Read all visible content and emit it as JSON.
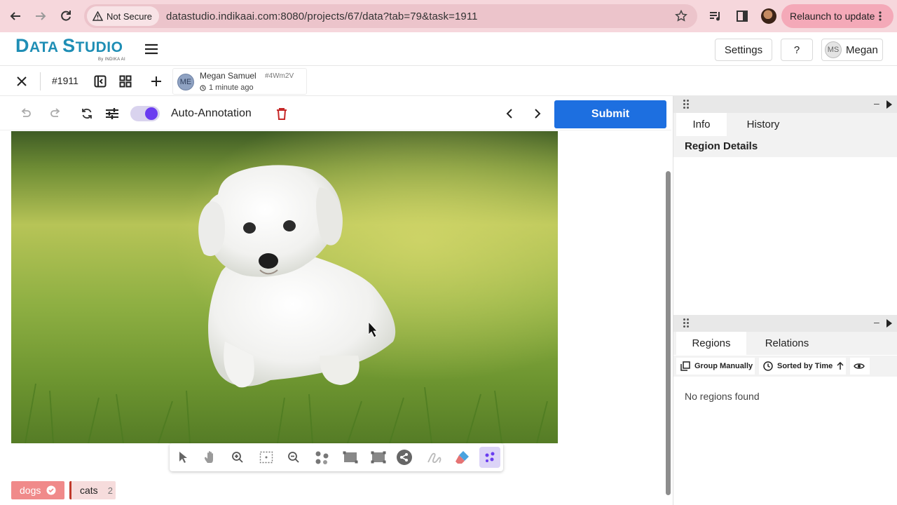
{
  "browser": {
    "security_label": "Not Secure",
    "url": "datastudio.indikaai.com:8080/projects/67/data?tab=79&task=1911",
    "relaunch_label": "Relaunch to update"
  },
  "app": {
    "logo_text_big1": "D",
    "logo_text_small1": "ATA ",
    "logo_text_big2": "S",
    "logo_text_small2": "TUDIO",
    "logo_sub": "By INDIKA AI",
    "settings_label": "Settings",
    "help_label": "?",
    "user_initials": "MS",
    "user_name": "Megan"
  },
  "task": {
    "id": "#1911",
    "annotator_initials": "ME",
    "annotator_name": "Megan Samuel",
    "annotator_code": "#4Wm2V",
    "updated": "1 minute ago"
  },
  "editor": {
    "auto_annotation_label": "Auto-Annotation",
    "auto_annotation_on": true,
    "submit_label": "Submit"
  },
  "labels": [
    {
      "name": "dogs",
      "checked": true,
      "color": "#f08a8a"
    },
    {
      "name": "cats",
      "count": "2",
      "color": "#f6dcdc"
    }
  ],
  "right_panel": {
    "top_tabs": [
      "Info",
      "History"
    ],
    "region_details_title": "Region Details",
    "bottom_tabs": [
      "Regions",
      "Relations"
    ],
    "group_manually_label": "Group Manually",
    "sorted_label": "Sorted by Time",
    "empty_text": "No regions found"
  },
  "colors": {
    "accent": "#1d6fe0",
    "toggle": "#6a3cf0",
    "browser_bar": "#f6d7dc"
  }
}
